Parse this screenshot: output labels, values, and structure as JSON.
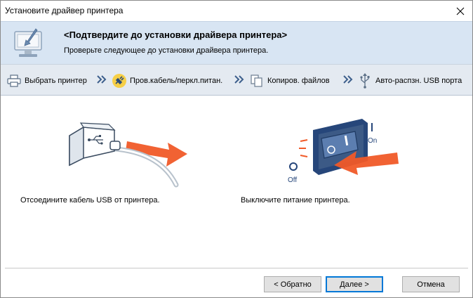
{
  "window": {
    "title": "Установите драйвер принтера"
  },
  "header": {
    "title": "<Подтвердите до установки драйвера принтера>",
    "subtitle": "Проверьте следующее до установки драйвера принтера."
  },
  "steps": [
    {
      "label": "Выбрать принтер",
      "icon": "printer-icon"
    },
    {
      "label": "Пров.кабель/перкл.питан.",
      "icon": "plug-icon",
      "active": true
    },
    {
      "label": "Копиров. файлов",
      "icon": "copy-files-icon"
    },
    {
      "label": "Авто-распзн. USB порта",
      "icon": "usb-icon"
    }
  ],
  "content": {
    "left_caption": "Отсоедините кабель USB от принтера.",
    "right_caption": "Выключите питание принтера.",
    "switch_on_label": "On",
    "switch_off_label": "Off"
  },
  "buttons": {
    "back": "< Обратно",
    "next": "Далее >",
    "cancel": "Отмена"
  },
  "colors": {
    "header_bg": "#d8e5f3",
    "steps_bg": "#e4eaf1",
    "accent_arrow": "#f05a28",
    "switch_body": "#3c5a86"
  }
}
